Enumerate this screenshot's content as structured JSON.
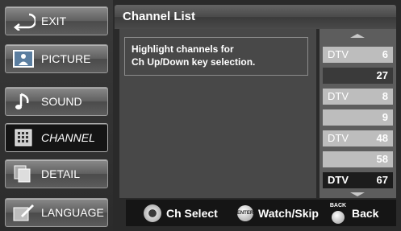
{
  "sidebar": {
    "items": [
      {
        "label": "EXIT",
        "icon": "exit-arrow-icon",
        "active": false
      },
      {
        "label": "PICTURE",
        "icon": "picture-icon",
        "active": false
      },
      {
        "label": "SOUND",
        "icon": "music-note-icon",
        "active": false
      },
      {
        "label": "CHANNEL",
        "icon": "channel-grid-icon",
        "active": true
      },
      {
        "label": "DETAIL",
        "icon": "detail-pages-icon",
        "active": false
      },
      {
        "label": "LANGUAGE",
        "icon": "pencil-icon",
        "active": false
      }
    ]
  },
  "header": {
    "title": "Channel List"
  },
  "content": {
    "help_line1": "Highlight channels for",
    "help_line2": "Ch Up/Down key selection."
  },
  "channels": [
    {
      "type": "DTV",
      "number": "6",
      "style": "light"
    },
    {
      "type": "",
      "number": "27",
      "style": "dark"
    },
    {
      "type": "DTV",
      "number": "8",
      "style": "light"
    },
    {
      "type": "",
      "number": "9",
      "style": "light"
    },
    {
      "type": "DTV",
      "number": "48",
      "style": "light"
    },
    {
      "type": "",
      "number": "58",
      "style": "light"
    },
    {
      "type": "DTV",
      "number": "67",
      "style": "selected"
    }
  ],
  "footer": {
    "select_label": "Ch Select",
    "enter_icon_text": "ENTER",
    "watch_label": "Watch/Skip",
    "back_icon_text": "BACK",
    "back_label": "Back"
  }
}
